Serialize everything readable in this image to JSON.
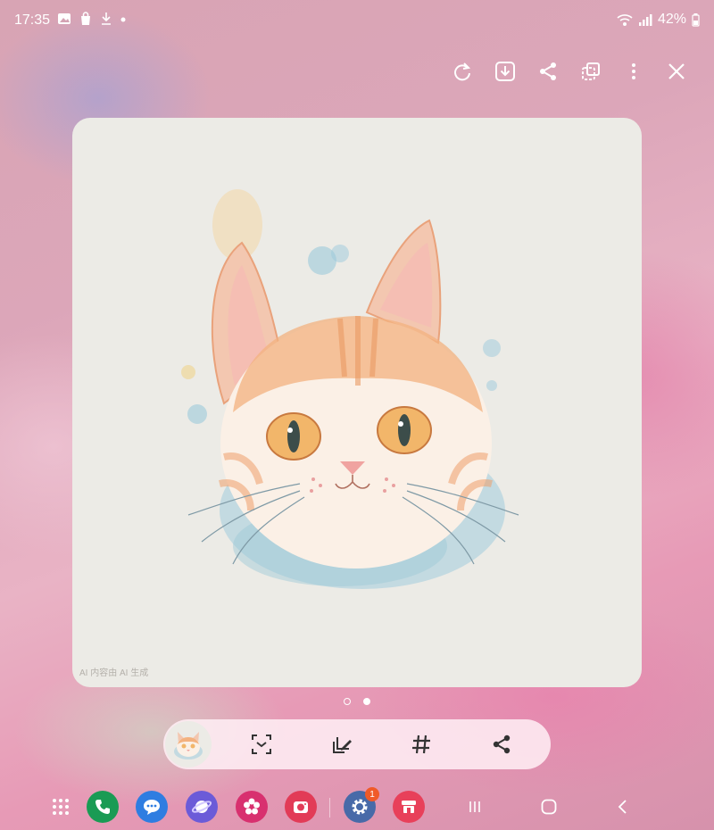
{
  "status_bar": {
    "time": "17:35",
    "battery": "42%",
    "left_icons": [
      "gallery-icon",
      "shopping-bag-icon",
      "download-icon",
      "notification-dot-icon"
    ],
    "right_icons": [
      "wifi-icon",
      "signal-icon",
      "battery-icon"
    ]
  },
  "viewer_toolbar": {
    "icons": [
      "rotate-icon",
      "download-icon",
      "share-icon",
      "crop-icon",
      "more-options-icon",
      "close-icon"
    ]
  },
  "image": {
    "watermark": "AI 内容由 AI 生成"
  },
  "pagination": {
    "total": 2,
    "current": 2
  },
  "bottom_toolbar": {
    "items": [
      "thumbnail",
      "scan-text-icon",
      "edit-icon",
      "hashtag-icon",
      "share-icon"
    ]
  },
  "taskbar": {
    "apps": [
      {
        "name": "app-drawer-icon",
        "color": "#ffffff"
      },
      {
        "name": "phone-icon",
        "color": "#1a9b54"
      },
      {
        "name": "messages-icon",
        "color": "#2f7de1"
      },
      {
        "name": "internet-icon",
        "color": "#6b5bd8"
      },
      {
        "name": "bixby-icon",
        "color": "#d8306f"
      },
      {
        "name": "camera-icon",
        "color": "#e23b57"
      },
      {
        "name": "settings-icon",
        "color": "#486aa8",
        "badge": "1"
      },
      {
        "name": "store-icon",
        "color": "#e8405a"
      }
    ],
    "nav": [
      "recents-icon",
      "home-icon",
      "back-icon"
    ]
  },
  "colors": {
    "card_background": "#ecebe6",
    "accent_badge": "#f05a28"
  }
}
